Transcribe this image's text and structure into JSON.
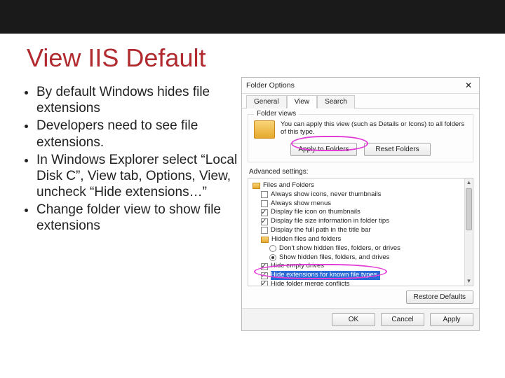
{
  "slide": {
    "title": "View IIS Default",
    "bullets": [
      "By default Windows hides file extensions",
      "Developers need to see file extensions.",
      "In Windows Explorer select “Local Disk C”, View tab, Options, View, uncheck “Hide extensions…”",
      "Change folder view to show file extensions"
    ]
  },
  "dialog": {
    "title": "Folder Options",
    "close_glyph": "✕",
    "tabs": {
      "general": "General",
      "view": "View",
      "search": "Search"
    },
    "folder_views": {
      "group_label": "Folder views",
      "description": "You can apply this view (such as Details or Icons) to all folders of this type.",
      "apply_btn": "Apply to Folders",
      "reset_btn": "Reset Folders"
    },
    "advanced_label": "Advanced settings:",
    "tree": {
      "root": "Files and Folders",
      "items": [
        {
          "label": "Always show icons, never thumbnails",
          "type": "check",
          "checked": false
        },
        {
          "label": "Always show menus",
          "type": "check",
          "checked": false
        },
        {
          "label": "Display file icon on thumbnails",
          "type": "check",
          "checked": true
        },
        {
          "label": "Display file size information in folder tips",
          "type": "check",
          "checked": true
        },
        {
          "label": "Display the full path in the title bar",
          "type": "check",
          "checked": false
        },
        {
          "label": "Hidden files and folders",
          "type": "header"
        },
        {
          "label": "Don't show hidden files, folders, or drives",
          "type": "radio",
          "checked": false,
          "indent": true
        },
        {
          "label": "Show hidden files, folders, and drives",
          "type": "radio",
          "checked": true,
          "indent": true
        },
        {
          "label": "Hide empty drives",
          "type": "check",
          "checked": true
        },
        {
          "label": "Hide extensions for known file types",
          "type": "check",
          "checked": true,
          "selected": true
        },
        {
          "label": "Hide folder merge conflicts",
          "type": "check",
          "checked": true
        }
      ]
    },
    "restore_btn": "Restore Defaults",
    "footer": {
      "ok": "OK",
      "cancel": "Cancel",
      "apply": "Apply"
    }
  }
}
